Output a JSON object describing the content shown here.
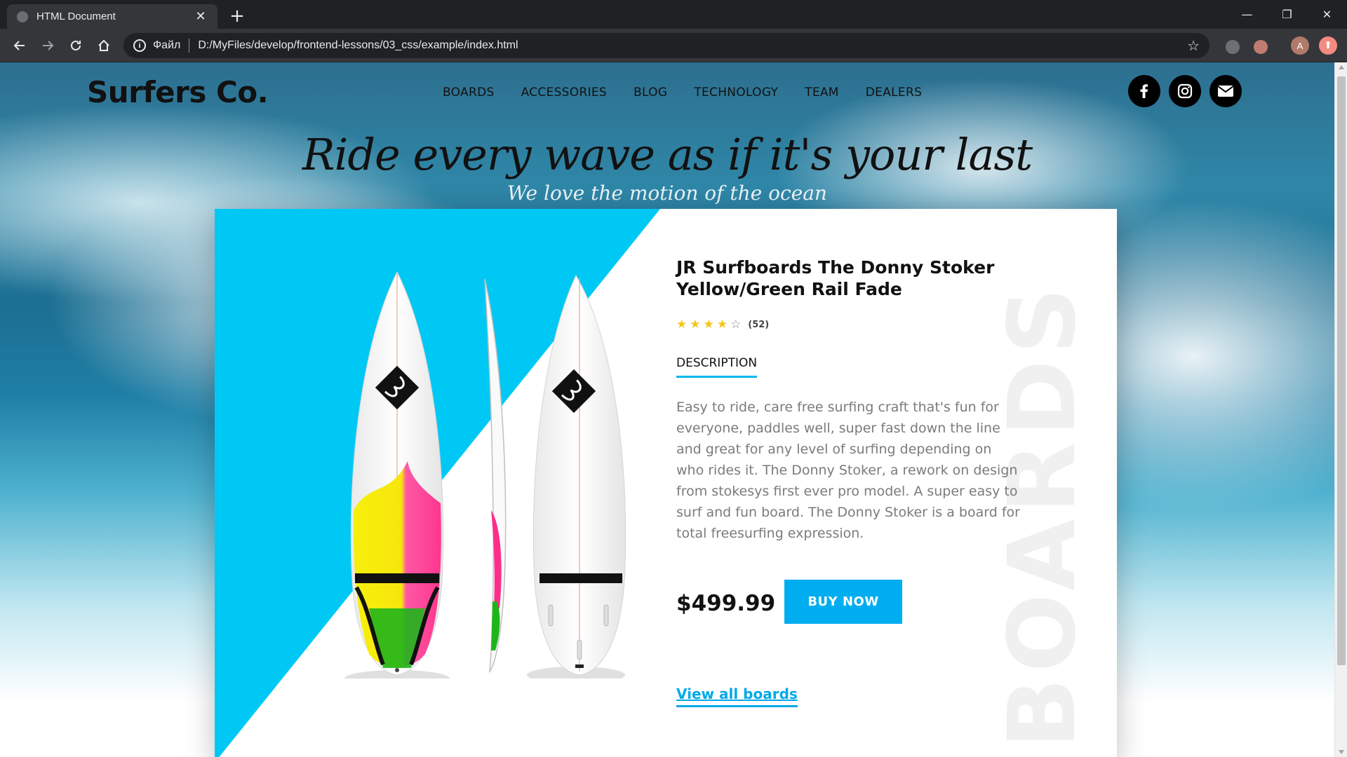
{
  "browser": {
    "tab_title": "HTML Document",
    "omnibox_scheme": "Файл",
    "omnibox_url": "D:/MyFiles/develop/frontend-lessons/03_css/example/index.html",
    "profile_initial": "A"
  },
  "site": {
    "brand": "Surfers Co.",
    "nav": [
      "BOARDS",
      "ACCESSORIES",
      "BLOG",
      "TECHNOLOGY",
      "TEAM",
      "DEALERS"
    ],
    "hero_title": "Ride every wave as if it's your last",
    "hero_subtitle": "We love the motion of the ocean",
    "watermark": "BOARDS"
  },
  "product": {
    "title": "JR Surfboards The Donny Stoker Yellow/Green Rail Fade",
    "rating_stars": 4,
    "rating_max": 5,
    "rating_count": "(52)",
    "tab_label": "DESCRIPTION",
    "description": "Easy to ride, care free surfing craft that's fun for everyone, paddles well, super fast down the line and great for any level of surfing depending on who rides it. The Donny Stoker, a rework on design from stokesys first ever pro model. A super easy to surf and fun board. The Donny Stoker is a board for total freesurfing expression.",
    "price": "$499.99",
    "buy_label": "BUY NOW",
    "view_all_label": "View all boards"
  },
  "colors": {
    "accent": "#00adf0",
    "triangle": "#00c8f5",
    "star": "#f5c518"
  }
}
